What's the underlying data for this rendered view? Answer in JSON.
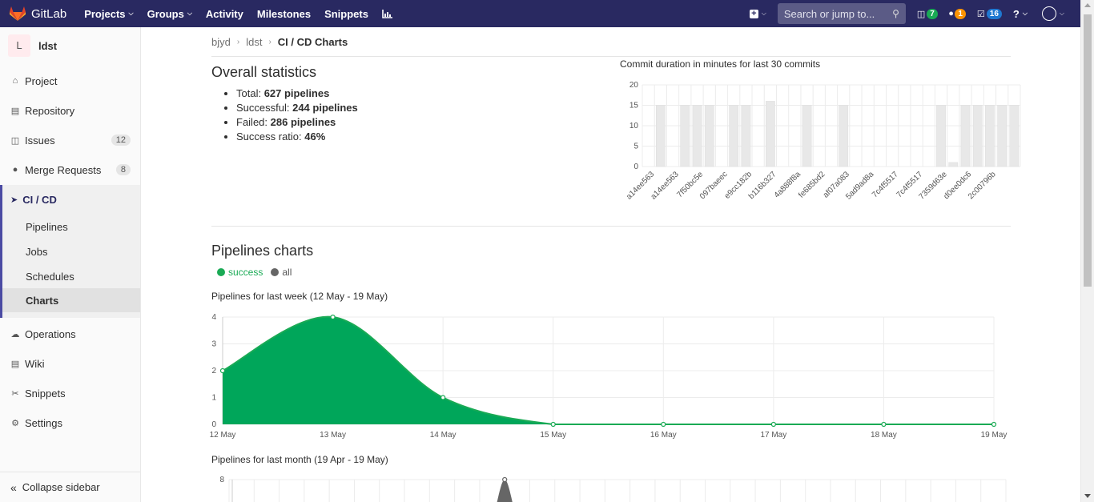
{
  "nav": {
    "brand": "GitLab",
    "links": [
      "Projects",
      "Groups",
      "Activity",
      "Milestones",
      "Snippets"
    ],
    "search_placeholder": "Search or jump to...",
    "issues_count": "7",
    "mr_count": "1",
    "todos_count": "16"
  },
  "sidebar": {
    "project_initial": "L",
    "project_name": "ldst",
    "items": {
      "project": "Project",
      "repository": "Repository",
      "issues": "Issues",
      "issues_count": "12",
      "merge_requests": "Merge Requests",
      "mr_count": "8",
      "cicd": "CI / CD",
      "pipelines": "Pipelines",
      "jobs": "Jobs",
      "schedules": "Schedules",
      "charts": "Charts",
      "operations": "Operations",
      "wiki": "Wiki",
      "snippets": "Snippets",
      "settings": "Settings"
    },
    "collapse": "Collapse sidebar"
  },
  "breadcrumb": {
    "group": "bjyd",
    "project": "ldst",
    "current": "CI / CD Charts"
  },
  "stats": {
    "title": "Overall statistics",
    "total_label": "Total: ",
    "total_value": "627 pipelines",
    "success_label": "Successful: ",
    "success_value": "244 pipelines",
    "failed_label": "Failed: ",
    "failed_value": "286 pipelines",
    "ratio_label": "Success ratio: ",
    "ratio_value": "46%"
  },
  "pipelines": {
    "title": "Pipelines charts",
    "legend_success": "success",
    "legend_all": "all",
    "week_title": "Pipelines for last week (12 May - 19 May)",
    "month_title": "Pipelines for last month (19 Apr - 19 May)"
  },
  "colors": {
    "nav_bg": "#292961",
    "success": "#1aaa55",
    "chart_fill": "#00a65a",
    "all": "#666666",
    "bar": "#e8e8e8"
  },
  "chart_data": [
    {
      "type": "bar",
      "title": "Commit duration in minutes for last 30 commits",
      "ylim": [
        0,
        20
      ],
      "yticks": [
        0,
        5,
        10,
        15,
        20
      ],
      "tick_labels": [
        "a14ee563",
        "a14ee563",
        "7f50bc5e",
        "097baeec",
        "e9cc182b",
        "b116b327",
        "4a888f8a",
        "fe685bd2",
        "af07a083",
        "5ad9ad8a",
        "7c4f5517",
        "7c4f5517",
        "7359d63e",
        "d0ee0dc6",
        "2c00796b"
      ],
      "values": [
        0,
        15,
        0,
        15,
        15,
        15,
        0,
        15,
        15,
        0,
        16,
        0,
        0,
        15,
        0,
        0,
        15,
        0,
        0,
        0,
        0,
        0,
        0,
        0,
        15,
        1,
        15,
        15,
        15,
        15,
        15
      ]
    },
    {
      "type": "area",
      "title": "Pipelines for last week (12 May - 19 May)",
      "categories": [
        "12 May",
        "13 May",
        "14 May",
        "15 May",
        "16 May",
        "17 May",
        "18 May",
        "19 May"
      ],
      "ylim": [
        0,
        4
      ],
      "yticks": [
        0,
        1,
        2,
        3,
        4
      ],
      "series": [
        {
          "name": "success",
          "values": [
            2,
            4,
            1,
            0,
            0,
            0,
            0,
            0
          ]
        },
        {
          "name": "all",
          "values": [
            2,
            4,
            1,
            0,
            0,
            0,
            0,
            0
          ]
        }
      ]
    },
    {
      "type": "area",
      "title": "Pipelines for last month (19 Apr - 19 May)",
      "yticks": [
        8
      ]
    }
  ]
}
